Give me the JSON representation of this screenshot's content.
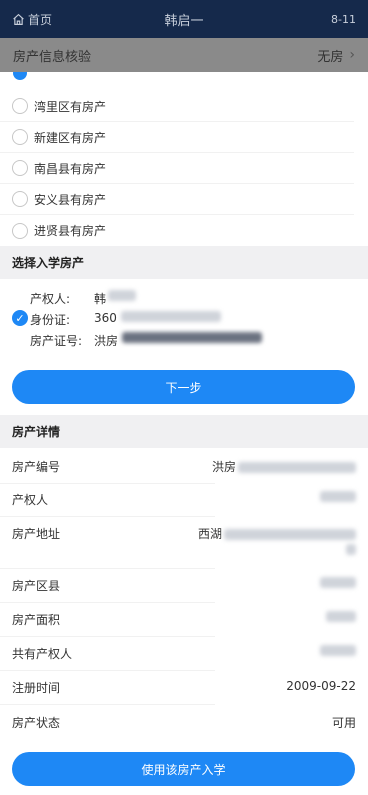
{
  "topbar": {
    "home_label": "首页",
    "title": "韩启一",
    "date": "8-11"
  },
  "verify": {
    "label": "房产信息核验",
    "value": "无房"
  },
  "radio_options": [
    {
      "label": "湾里区有房产"
    },
    {
      "label": "新建区有房产"
    },
    {
      "label": "南昌县有房产"
    },
    {
      "label": "安义县有房产"
    },
    {
      "label": "进贤县有房产"
    }
  ],
  "select_section": {
    "title": "选择入学房产"
  },
  "owner": {
    "owner_label": "产权人:",
    "owner_value": "韩",
    "id_label": "身份证:",
    "id_value": "360",
    "cert_label": "房产证号:",
    "cert_value": "洪房"
  },
  "next_button": "下一步",
  "detail_section": {
    "title": "房产详情"
  },
  "details": {
    "house_no_label": "房产编号",
    "house_no_value": "洪房",
    "owner_label": "产权人",
    "address_label": "房产地址",
    "address_value": "西湖",
    "district_label": "房产区县",
    "area_label": "房产面积",
    "co_owner_label": "共有产权人",
    "reg_time_label": "注册时间",
    "reg_time_value": "2009-09-22",
    "status_label": "房产状态",
    "status_value": "可用"
  },
  "use_button": "使用该房产入学",
  "colors": {
    "accent": "#1e88f5",
    "topbar": "#15294b",
    "section_bg": "#f0f0f2"
  }
}
